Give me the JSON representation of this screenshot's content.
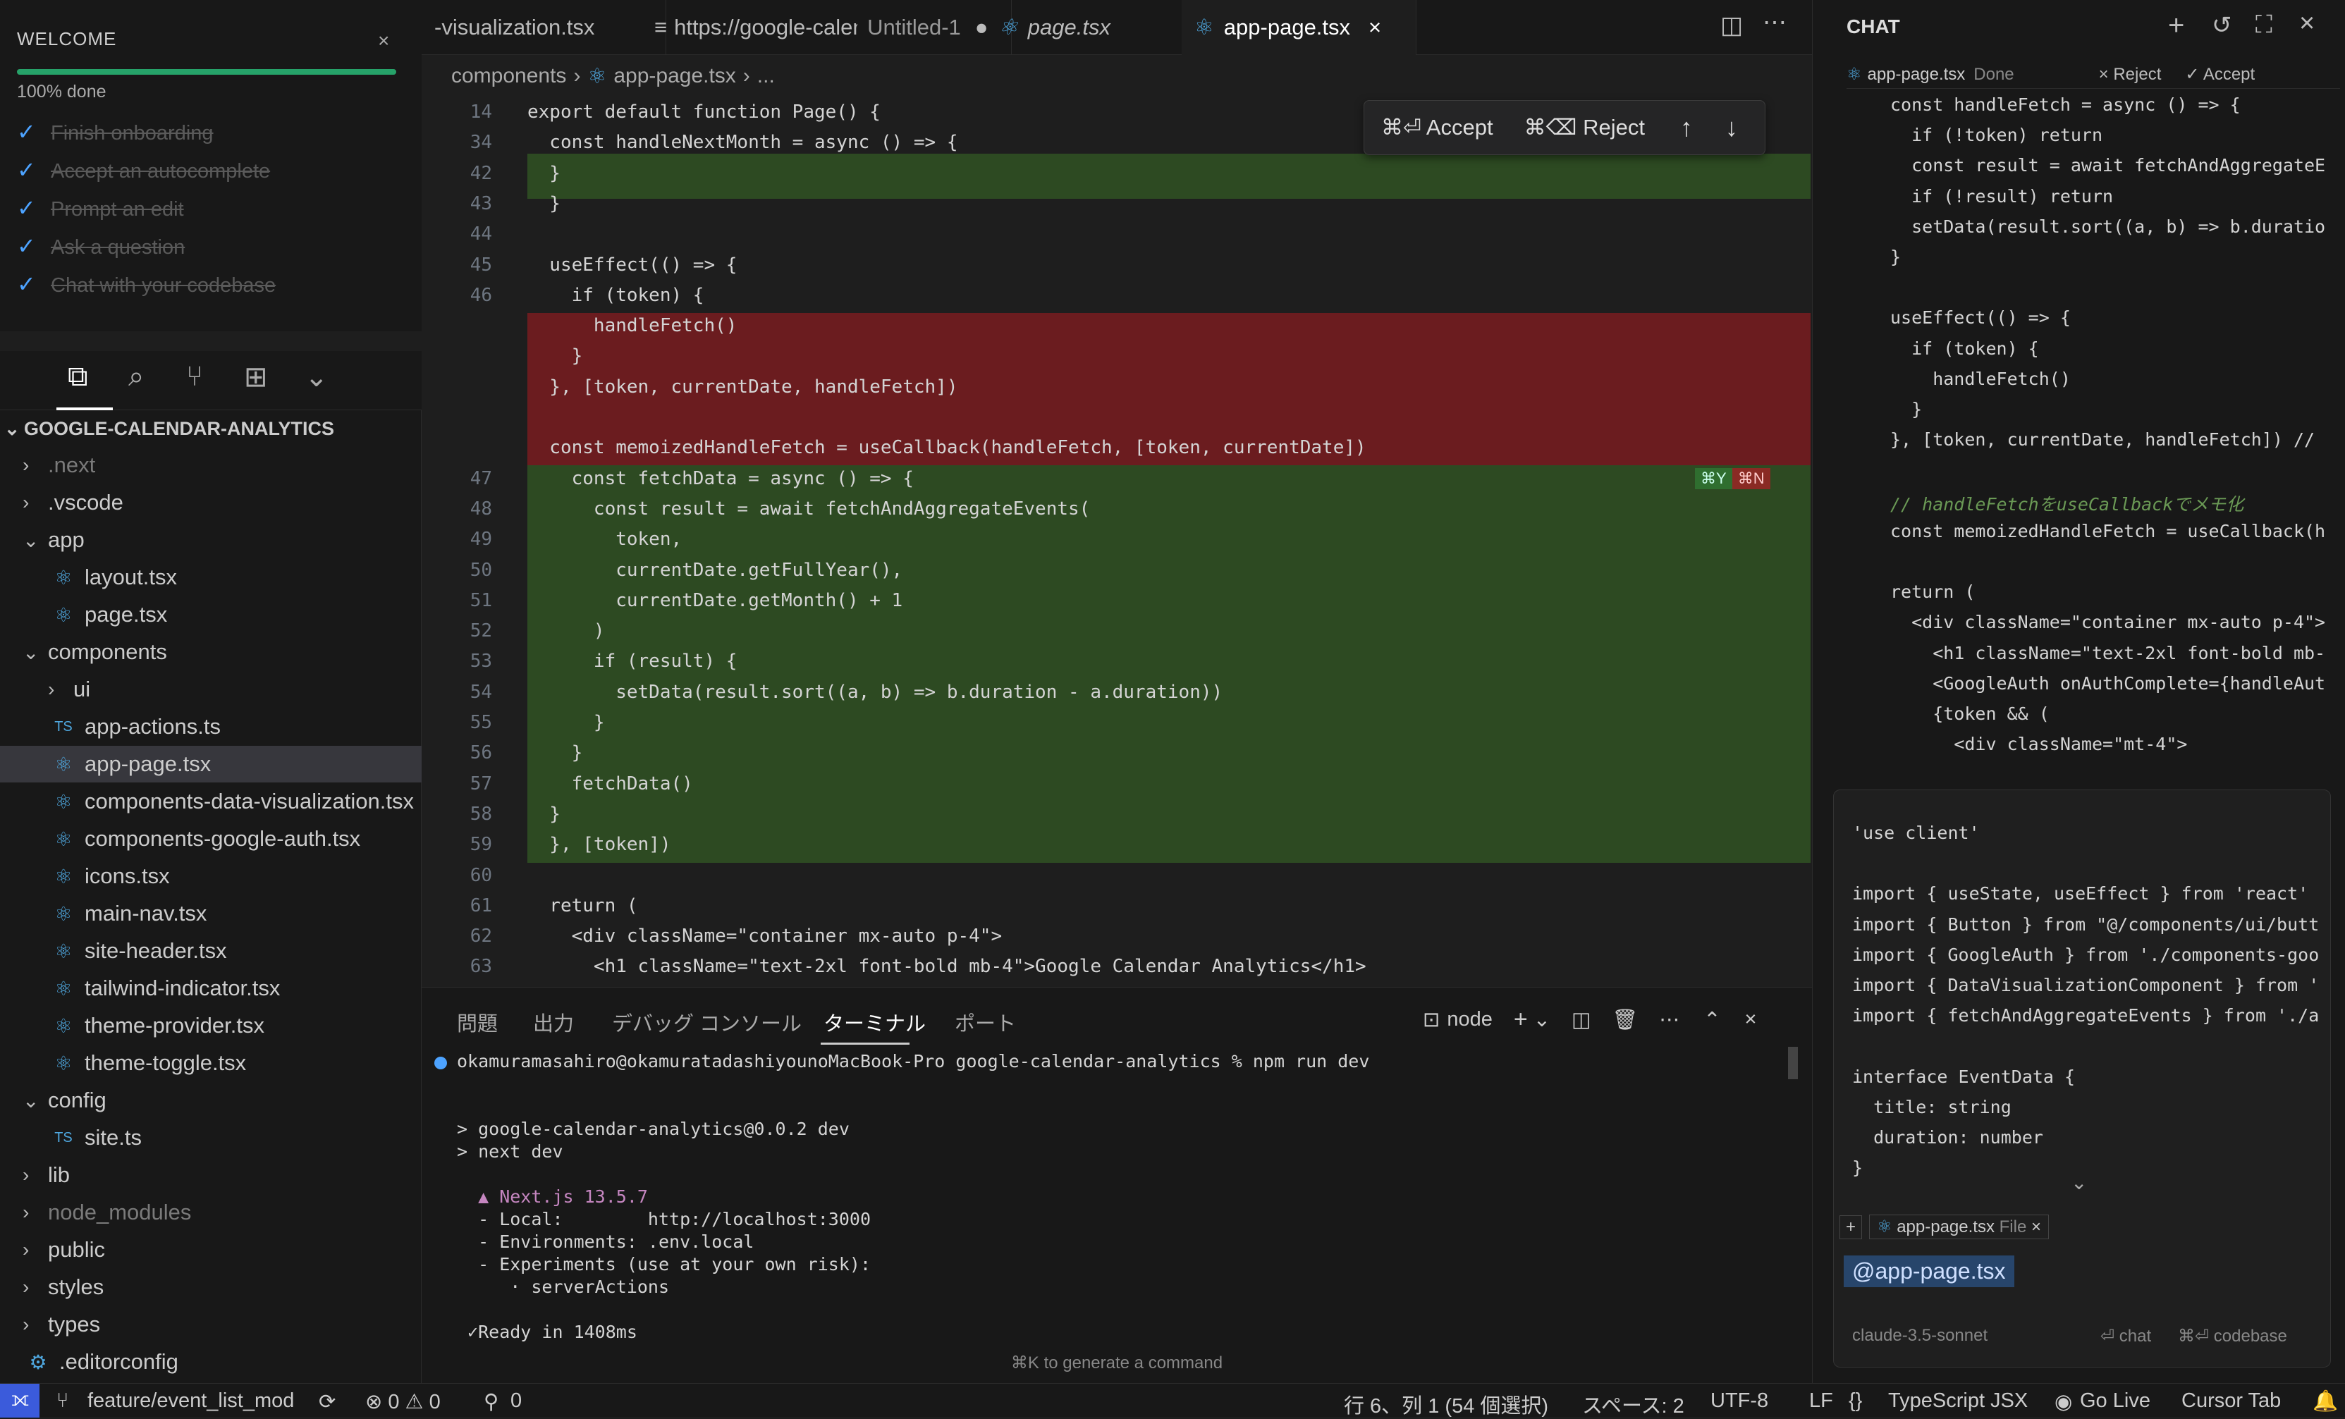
{
  "welcome": {
    "title": "WELCOME",
    "progress_label": "100% done",
    "progress_fraction": 1.0,
    "items": [
      "Finish onboarding",
      "Accept an autocomplete",
      "Prompt an edit",
      "Ask a question",
      "Chat with your codebase"
    ]
  },
  "explorer": {
    "root": "GOOGLE-CALENDAR-ANALYTICS",
    "items": [
      {
        "label": ".next",
        "kind": "folder"
      },
      {
        "label": ".vscode",
        "kind": "folder"
      },
      {
        "label": "app",
        "kind": "folder-open"
      },
      {
        "label": "layout.tsx",
        "kind": "react"
      },
      {
        "label": "page.tsx",
        "kind": "react"
      },
      {
        "label": "components",
        "kind": "folder-open"
      },
      {
        "label": "ui",
        "kind": "folder"
      },
      {
        "label": "app-actions.ts",
        "kind": "ts"
      },
      {
        "label": "app-page.tsx",
        "kind": "react"
      },
      {
        "label": "components-data-visualization.tsx",
        "kind": "react"
      },
      {
        "label": "components-google-auth.tsx",
        "kind": "react"
      },
      {
        "label": "icons.tsx",
        "kind": "react"
      },
      {
        "label": "main-nav.tsx",
        "kind": "react"
      },
      {
        "label": "site-header.tsx",
        "kind": "react"
      },
      {
        "label": "tailwind-indicator.tsx",
        "kind": "react"
      },
      {
        "label": "theme-provider.tsx",
        "kind": "react"
      },
      {
        "label": "theme-toggle.tsx",
        "kind": "react"
      },
      {
        "label": "config",
        "kind": "folder-open"
      },
      {
        "label": "site.ts",
        "kind": "ts"
      },
      {
        "label": "lib",
        "kind": "folder"
      },
      {
        "label": "node_modules",
        "kind": "folder"
      },
      {
        "label": "public",
        "kind": "folder"
      },
      {
        "label": "styles",
        "kind": "folder"
      },
      {
        "label": "types",
        "kind": "folder"
      },
      {
        "label": ".editorconfig",
        "kind": "gear"
      }
    ]
  },
  "tabs": {
    "t1": "-visualization.tsx",
    "t2": "https://google-calendar-analytics-git-de",
    "t2b": "Untitled-1",
    "t3": "page.tsx",
    "t4": "app-page.tsx"
  },
  "breadcrumb": {
    "a": "components",
    "b": "app-page.tsx",
    "c": "..."
  },
  "acceptbar": {
    "accept": "⌘⏎ Accept",
    "reject": "⌘⌫ Reject"
  },
  "inline_keys": {
    "yes": "⌘Y",
    "no": "⌘N"
  },
  "editor": {
    "lines": [
      {
        "n": "14",
        "t": "export default function Page() {"
      },
      {
        "n": "34",
        "t": "  const handleNextMonth = async () => {"
      },
      {
        "n": "42",
        "t": "  }"
      },
      {
        "n": "43",
        "t": "  }"
      },
      {
        "n": "44",
        "t": ""
      },
      {
        "n": "45",
        "t": "  useEffect(() => {"
      },
      {
        "n": "46",
        "t": "    if (token) {"
      },
      {
        "n": "",
        "t": "      handleFetch()"
      },
      {
        "n": "",
        "t": "    }"
      },
      {
        "n": "",
        "t": "  }, [token, currentDate, handleFetch])"
      },
      {
        "n": "",
        "t": ""
      },
      {
        "n": "",
        "t": "  const memoizedHandleFetch = useCallback(handleFetch, [token, currentDate])"
      },
      {
        "n": "47",
        "t": "    const fetchData = async () => {"
      },
      {
        "n": "48",
        "t": "      const result = await fetchAndAggregateEvents("
      },
      {
        "n": "49",
        "t": "        token,"
      },
      {
        "n": "50",
        "t": "        currentDate.getFullYear(),"
      },
      {
        "n": "51",
        "t": "        currentDate.getMonth() + 1"
      },
      {
        "n": "52",
        "t": "      )"
      },
      {
        "n": "53",
        "t": "      if (result) {"
      },
      {
        "n": "54",
        "t": "        setData(result.sort((a, b) => b.duration - a.duration))"
      },
      {
        "n": "55",
        "t": "      }"
      },
      {
        "n": "56",
        "t": "    }"
      },
      {
        "n": "57",
        "t": "    fetchData()"
      },
      {
        "n": "58",
        "t": "  }"
      },
      {
        "n": "59",
        "t": "  }, [token])"
      },
      {
        "n": "60",
        "t": ""
      },
      {
        "n": "61",
        "t": "  return ("
      },
      {
        "n": "62",
        "t": "    <div className=\"container mx-auto p-4\">"
      },
      {
        "n": "63",
        "t": "      <h1 className=\"text-2xl font-bold mb-4\">Google Calendar Analytics</h1>"
      }
    ]
  },
  "panel": {
    "tabs": [
      "問題",
      "出力",
      "デバッグ コンソール",
      "ターミナル",
      "ポート"
    ],
    "shell": "node",
    "lines": [
      "okamuramasahiro@okamuratadashiyounoMacBook-Pro google-calendar-analytics % npm run dev",
      "",
      "",
      "> google-calendar-analytics@0.0.2 dev",
      "> next dev",
      "",
      "  ▲ Next.js 13.5.7",
      "  - Local:        http://localhost:3000",
      "  - Environments: .env.local",
      "  - Experiments (use at your own risk):",
      "     · serverActions",
      "",
      " ✓Ready in 1408ms"
    ],
    "hint": "⌘K to generate a command"
  },
  "chat": {
    "title": "CHAT",
    "file": "app-page.tsx",
    "status": "Done",
    "reject": "Reject",
    "accept": "Accept",
    "lines": [
      "const handleFetch = async () => {",
      "  if (!token) return",
      "  const result = await fetchAndAggregateE",
      "  if (!result) return",
      "  setData(result.sort((a, b) => b.duratio",
      "}",
      "",
      "useEffect(() => {",
      "  if (token) {",
      "    handleFetch()",
      "  }",
      "}, [token, currentDate, handleFetch]) //",
      "",
      "// handleFetchをuseCallbackでメモ化",
      "const memoizedHandleFetch = useCallback(h",
      "",
      "return (",
      "  <div className=\"container mx-auto p-4\">",
      "    <h1 className=\"text-2xl font-bold mb-",
      "    <GoogleAuth onAuthComplete={handleAut",
      "    {token && (",
      "      <div className=\"mt-4\">"
    ],
    "input_lines": [
      "'use client'",
      "",
      "import { useState, useEffect } from 'react'",
      "import { Button } from \"@/components/ui/butt",
      "import { GoogleAuth } from './components-goo",
      "import { DataVisualizationComponent } from '",
      "import { fetchAndAggregateEvents } from './a",
      "",
      "interface EventData {",
      "  title: string",
      "  duration: number",
      "}"
    ],
    "chip_file": "app-page.tsx",
    "chip_kind": "File",
    "mention": "@app-page.tsx",
    "model": "claude-3.5-sonnet",
    "send_chat": "⏎ chat",
    "send_codebase": "⌘⏎ codebase"
  },
  "status": {
    "branch": "feature/event_list_mod",
    "problems": "⊗ 0 ⚠ 0",
    "ports": "0",
    "position": "行 6、列 1 (54 個選択)",
    "spaces": "スペース: 2",
    "encoding": "UTF-8",
    "eol": "LF",
    "language": "TypeScript JSX",
    "golive": "Go Live",
    "cursortab": "Cursor Tab"
  },
  "colors": {
    "added_bg": "#2d4a22",
    "removed_bg": "#6b1c1f",
    "accent": "#26a269",
    "link": "#4da3ff"
  }
}
